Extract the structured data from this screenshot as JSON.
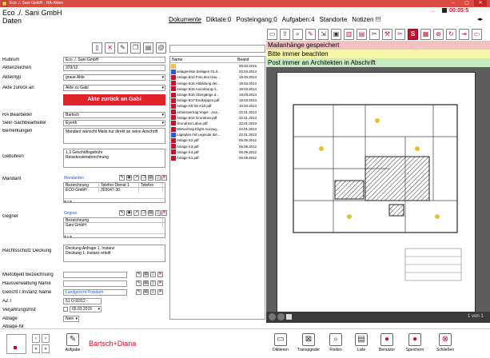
{
  "window": {
    "title": "Eco ./. Sani GmbH - RA-Akten",
    "min": "–",
    "max": "▢",
    "close": "✕"
  },
  "header": {
    "case": "Eco ./. Sani GmbH",
    "section": "Daten",
    "timer": "00:05:5",
    "dots": "..."
  },
  "tabs": [
    {
      "label": "Dokumente"
    },
    {
      "label": "Diktate:0"
    },
    {
      "label": "Posteingang:0"
    },
    {
      "label": "Aufgaben:4"
    },
    {
      "label": "Standorte"
    },
    {
      "label": "Notizen !!!"
    }
  ],
  "form": {
    "rubrum": {
      "label": "Rubrum",
      "value": "Eco ./. Sani GmbH"
    },
    "aktenzeichen": {
      "label": "Aktenzeichen",
      "value": "379/12"
    },
    "aktentyp": {
      "label": "Aktentyp",
      "value": "graue Akte"
    },
    "zurueck": {
      "label": "Akte zurück an",
      "value": "Akte zu Gabi",
      "button": "Akte zurück an Gabi"
    },
    "bearbeiter": {
      "label": "RA Bearbeiter",
      "value": "Bartsch"
    },
    "sekr": {
      "label": "Sekr-Sachbearbeiter",
      "value": "Eyerth"
    },
    "bemerkungen": {
      "label": "Bemerkungen",
      "value": "Mandant wünscht Mails nur direkt an seine Anschrift"
    },
    "gebuehren": {
      "label": "Gebühren",
      "line1": "1,3 Geschäftsgebühr",
      "line2": "Reisekostenabrechnung"
    },
    "mandant": {
      "label": "Mandant",
      "link": "Mandanten",
      "cols": [
        "Bezeichnung",
        "Telefon Dienst 1",
        "Telefon"
      ],
      "row": [
        "ECO  GmbH",
        "303047-30",
        ""
      ]
    },
    "gegner": {
      "label": "Gegner",
      "link": "Gegner",
      "col": "Bezeichnung",
      "row": "Sani GmbH"
    },
    "rechtsschutz": {
      "label": "Rechtsschutz Deckung",
      "line1": "Deckung Anfrage 1. Instanz",
      "line2": "Deckung 1. Instanz erteilt"
    },
    "mietobjekt": {
      "label": "Mietobjekt Bezeichnung",
      "value": ""
    },
    "hausverwaltung": {
      "label": "Hausverwaltung Name",
      "value": ""
    },
    "gericht": {
      "label": "Gericht I.Instanz Name",
      "value": "Landgericht Potsdam"
    },
    "az": {
      "label": "AZ I",
      "value": "51 O 92/12 -"
    },
    "verjaehrung": {
      "label": "Verjährungsfrist",
      "value": "05.03.2015"
    },
    "ablage": {
      "label": "Ablage",
      "value": "Nein"
    },
    "ablagenr": {
      "label": "Ablage-Nr",
      "value": ""
    }
  },
  "files": {
    "col_name": "Name",
    "col_date": "Beand",
    "items": [
      {
        "type": "fol",
        "name": "",
        "date": "05.03.2015"
      },
      {
        "type": "doc",
        "name": "anlagenliste beilagen 01.d...",
        "date": "20.03.2014"
      },
      {
        "type": "pdf",
        "name": "Anlage B13 Foto des Hau...",
        "date": "19.03.2014"
      },
      {
        "type": "pdf",
        "name": "Anlage B16 Abbildung der...",
        "date": "19.03.2014"
      },
      {
        "type": "pdf",
        "name": "Anlage B15 Anordnung d...",
        "date": "19.03.2014"
      },
      {
        "type": "pdf",
        "name": "Anlage B16 Übergänge d...",
        "date": "19.03.2014"
      },
      {
        "type": "pdf",
        "name": "Anlage B17 Endköppen.pdf",
        "date": "19.03.2014"
      },
      {
        "type": "pdf",
        "name": "Anlage K8 bis K10.pdf",
        "date": "10.03.2014"
      },
      {
        "type": "pdf",
        "name": "Arbeitsvertrag Vogel - Ava...",
        "date": "22.01.2013"
      },
      {
        "type": "pdf",
        "name": "Anlage B14 Grundriss.pdf",
        "date": "22.01.2013"
      },
      {
        "type": "pdf",
        "name": "Grundriss Labor.pdf",
        "date": "22.01.2013"
      },
      {
        "type": "pdf",
        "name": "Mietvertrag Elight Auszug...",
        "date": "22.01.2013"
      },
      {
        "type": "doc",
        "name": "Lageplan mit Legende der...",
        "date": "22.01.2013"
      },
      {
        "type": "pdf",
        "name": "Anlage K2.pdf",
        "date": "06.09.2012"
      },
      {
        "type": "pdf",
        "name": "Anlage K3.pdf",
        "date": "06.09.2012"
      },
      {
        "type": "pdf",
        "name": "Anlage K4.pdf",
        "date": "06.09.2012"
      },
      {
        "type": "pdf",
        "name": "Anlage K1.pdf",
        "date": "06.09.2012"
      }
    ]
  },
  "notes": [
    "Mailanhänge gespeichert",
    "Bitte immer beachten",
    "Post immer an Architekten in Abschrift"
  ],
  "preview": {
    "page": "1 von 1"
  },
  "footer": {
    "users": "Bartsch+Diana",
    "aufgabe": "Aufgabe",
    "buttons": [
      {
        "label": "Diktieren",
        "icon": "▭"
      },
      {
        "label": "Transpgnder",
        "icon": "⊠"
      },
      {
        "label": "Finden",
        "icon": "⌕"
      },
      {
        "label": "Liste",
        "icon": "▤"
      },
      {
        "label": "Benutzer",
        "icon": "●"
      },
      {
        "label": "Speichern",
        "icon": "●"
      },
      {
        "label": "Schließen",
        "icon": "⊗"
      }
    ]
  },
  "colors": {
    "accent": "#c8102e",
    "titlebar": "#d94a42",
    "note_red": "#f3c1c1",
    "note_yellow": "#f6f6a8",
    "note_green": "#c6ecbf"
  }
}
